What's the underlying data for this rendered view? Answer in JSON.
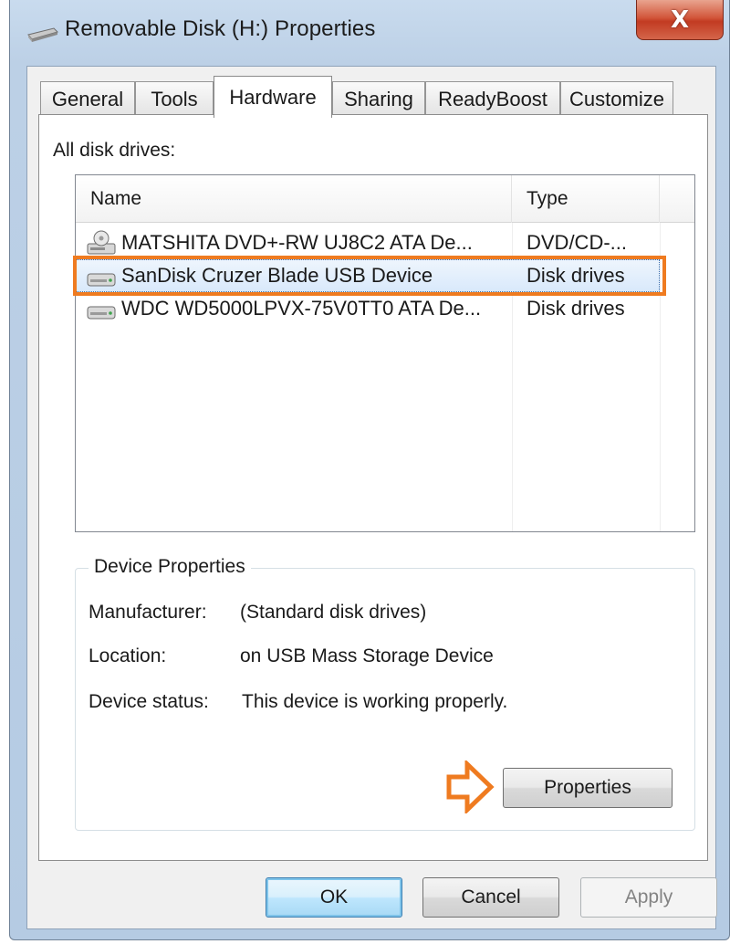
{
  "window": {
    "title": "Removable Disk (H:) Properties",
    "close_label": "X"
  },
  "tabs": [
    {
      "label": "General",
      "active": false
    },
    {
      "label": "Tools",
      "active": false
    },
    {
      "label": "Hardware",
      "active": true
    },
    {
      "label": "Sharing",
      "active": false
    },
    {
      "label": "ReadyBoost",
      "active": false
    },
    {
      "label": "Customize",
      "active": false
    }
  ],
  "hardware": {
    "section_label": "All disk drives:",
    "columns": [
      "Name",
      "Type"
    ],
    "rows": [
      {
        "name": "MATSHITA DVD+-RW UJ8C2 ATA De...",
        "type": "DVD/CD-...",
        "icon": "optical-drive-icon",
        "selected": false
      },
      {
        "name": "SanDisk Cruzer Blade USB Device",
        "type": "Disk drives",
        "icon": "disk-drive-icon",
        "selected": true
      },
      {
        "name": "WDC WD5000LPVX-75V0TT0 ATA De...",
        "type": "Disk drives",
        "icon": "disk-drive-icon",
        "selected": false
      }
    ],
    "device_properties": {
      "title": "Device Properties",
      "manufacturer_label": "Manufacturer:",
      "manufacturer_value": "(Standard disk drives)",
      "location_label": "Location:",
      "location_value": "on USB Mass Storage Device",
      "status_label": "Device status:",
      "status_value": "This device is working properly.",
      "properties_button": "Properties"
    }
  },
  "buttons": {
    "ok": "OK",
    "cancel": "Cancel",
    "apply": "Apply"
  },
  "colors": {
    "highlight": "#ef7b20",
    "selection": "#d9e9fb",
    "close_button": "#c23b22"
  }
}
